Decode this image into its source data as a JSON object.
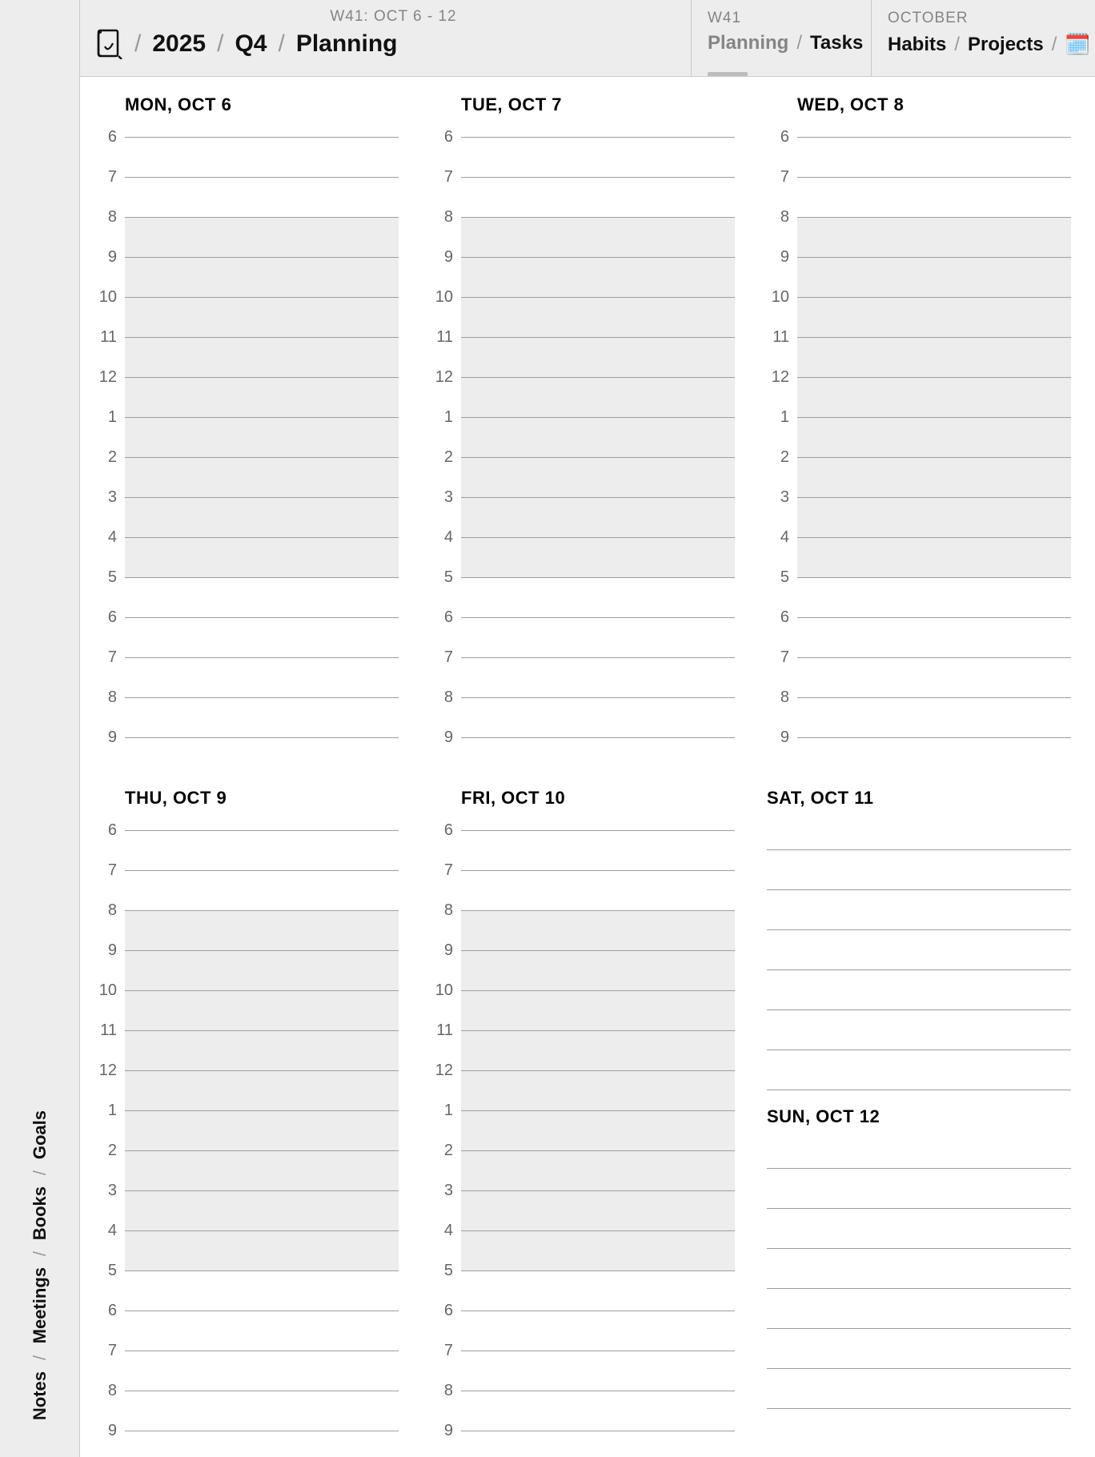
{
  "header": {
    "week_subtitle": "W41: OCT 6 - 12",
    "breadcrumb": {
      "year": "2025",
      "quarter": "Q4",
      "page": "Planning"
    },
    "box_week": {
      "title": "W41",
      "link_muted": "Planning",
      "link_bold": "Tasks"
    },
    "box_month": {
      "title": "OCTOBER",
      "link1": "Habits",
      "link2": "Projects"
    }
  },
  "rail": {
    "notes": "Notes",
    "meetings": "Meetings",
    "books": "Books",
    "goals": "Goals"
  },
  "hours": [
    "6",
    "7",
    "8",
    "9",
    "10",
    "11",
    "12",
    "1",
    "2",
    "3",
    "4",
    "5",
    "6",
    "7",
    "8",
    "9"
  ],
  "work_block": {
    "start_index": 3,
    "end_index": 12
  },
  "days": {
    "mon": "MON, OCT 6",
    "tue": "TUE, OCT 7",
    "wed": "WED, OCT 8",
    "thu": "THU, OCT 9",
    "fri": "FRI, OCT 10",
    "sat": "SAT, OCT 11",
    "sun": "SUN, OCT 12"
  },
  "weekend_lines": 7
}
